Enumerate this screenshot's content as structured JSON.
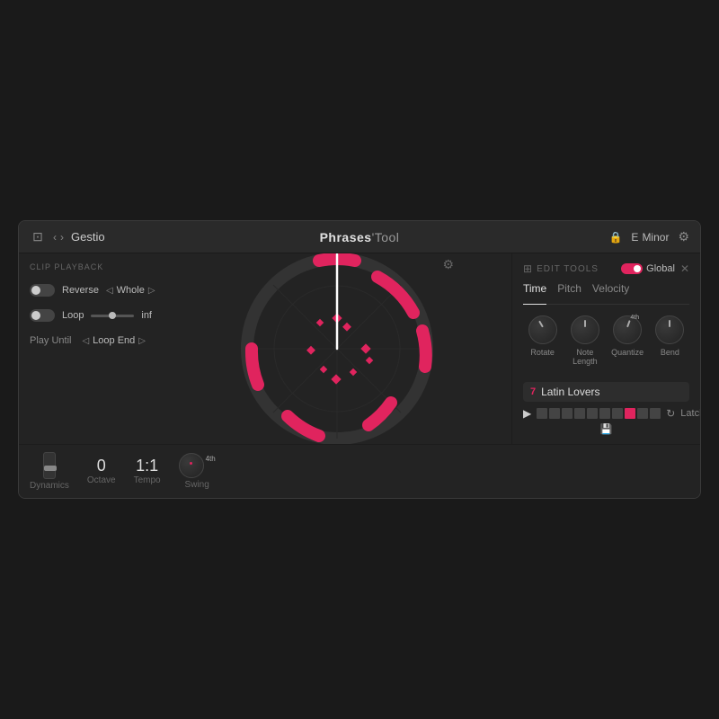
{
  "header": {
    "title": "Gestio",
    "center": "Phrases",
    "center_tool": "'Tool",
    "key": "E",
    "mode": "Minor"
  },
  "clip_playback": {
    "label": "CLIP PLAYBACK",
    "reverse_label": "Reverse",
    "whole_label": "Whole",
    "loop_label": "Loop",
    "loop_end_label": "Loop End",
    "play_until_label": "Play Until",
    "slider_value": "inf"
  },
  "bottom_controls": {
    "dynamics_label": "Dynamics",
    "octave_label": "Octave",
    "octave_value": "0",
    "tempo_label": "Tempo",
    "tempo_value": "1:1",
    "swing_label": "Swing",
    "swing_superscript": "4th"
  },
  "edit_tools": {
    "label": "EDIT TOOLS",
    "global_label": "Global",
    "tabs": [
      "Time",
      "Pitch",
      "Velocity"
    ],
    "active_tab": "Time",
    "rotate_label": "Rotate",
    "note_length_label": "Note Length",
    "quantize_label": "Quantize",
    "quantize_superscript": "4th",
    "bend_label": "Bend"
  },
  "pattern": {
    "number": "7",
    "name": "Latin Lovers",
    "latch_label": "Latch",
    "beats": [
      false,
      false,
      false,
      false,
      false,
      false,
      false,
      true,
      false,
      false
    ]
  }
}
